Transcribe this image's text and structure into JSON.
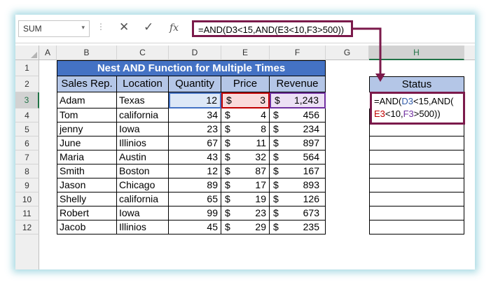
{
  "formula_bar": {
    "name_box": "SUM",
    "name_box_arrow": "▾",
    "cancel_icon": "✕",
    "enter_icon": "✓",
    "fx_label": "fx",
    "formula": "=AND(D3<15,AND(E3<10,F3>500))"
  },
  "columns": [
    "A",
    "B",
    "C",
    "D",
    "E",
    "F",
    "G",
    "H"
  ],
  "rows": [
    "1",
    "2",
    "3",
    "4",
    "5",
    "6",
    "7",
    "8",
    "9",
    "10",
    "11",
    "12"
  ],
  "selected_column": "H",
  "selected_row": "3",
  "table": {
    "title": "Nest AND Function for Multiple Times",
    "headers": [
      "Sales Rep.",
      "Location",
      "Quantity",
      "Price",
      "Revenue"
    ],
    "currency_symbol": "$",
    "data": [
      {
        "rep": "Adam",
        "loc": "Texas",
        "qty": "12",
        "price": "3",
        "rev": "1,243"
      },
      {
        "rep": "Tom",
        "loc": "california",
        "qty": "34",
        "price": "4",
        "rev": "456"
      },
      {
        "rep": "jenny",
        "loc": "Iowa",
        "qty": "23",
        "price": "8",
        "rev": "234"
      },
      {
        "rep": "June",
        "loc": "Illinios",
        "qty": "67",
        "price": "11",
        "rev": "897"
      },
      {
        "rep": "Maria",
        "loc": "Austin",
        "qty": "43",
        "price": "32",
        "rev": "564"
      },
      {
        "rep": "Smith",
        "loc": "Boston",
        "qty": "12",
        "price": "87",
        "rev": "167"
      },
      {
        "rep": "Jason",
        "loc": "Chicago",
        "qty": "89",
        "price": "17",
        "rev": "893"
      },
      {
        "rep": "Shelly",
        "loc": "california",
        "qty": "65",
        "price": "19",
        "rev": "126"
      },
      {
        "rep": "Robert",
        "loc": "Iowa",
        "qty": "99",
        "price": "23",
        "rev": "673"
      },
      {
        "rep": "Jacob",
        "loc": "Illinios",
        "qty": "45",
        "price": "29",
        "rev": "235"
      }
    ]
  },
  "status": {
    "header": "Status",
    "formula_parts": [
      "=AND(",
      "D3",
      "<15,AND(",
      "E3",
      "<10,",
      "F3",
      ">500))"
    ]
  },
  "colors": {
    "title_bg": "#4472c4",
    "header_bg": "#b4c6e7",
    "highlight_border": "#7b1a4b",
    "ref_d": "#4472c4",
    "ref_e": "#c00000",
    "ref_f": "#7030a0"
  }
}
